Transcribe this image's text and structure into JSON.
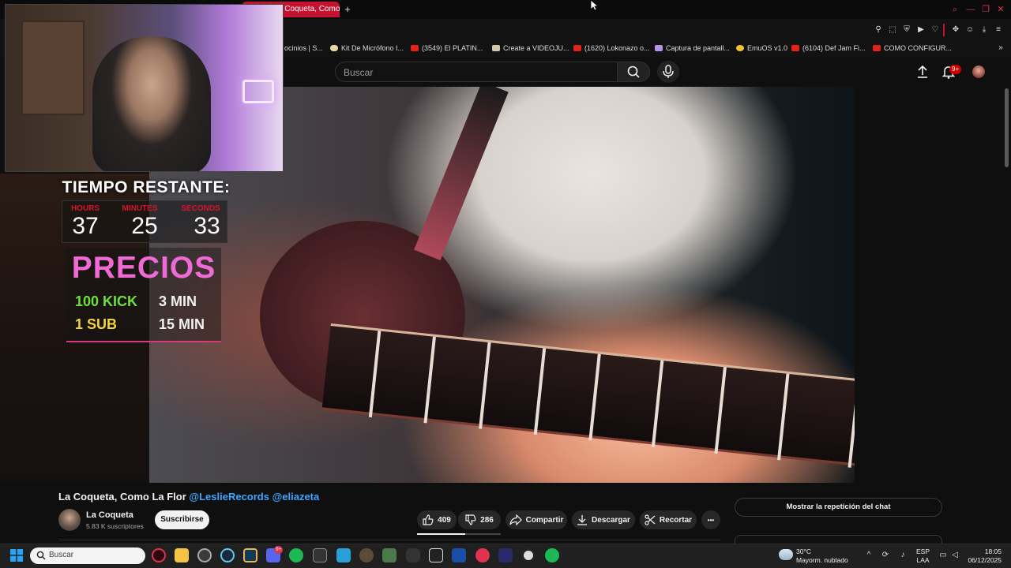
{
  "browser": {
    "active_tab_title": "a Coqueta, Como",
    "bookmarks": [
      {
        "label": "ocinios | S...",
        "icon": "page-icon"
      },
      {
        "label": "Kit De Micrófono I...",
        "icon": "pill-icon"
      },
      {
        "label": "(3549) El PLATIN...",
        "icon": "youtube-icon"
      },
      {
        "label": "Create a VIDEOJU...",
        "icon": "page-icon"
      },
      {
        "label": "(1620) Lokonazo o...",
        "icon": "youtube-icon"
      },
      {
        "label": "Captura de pantall...",
        "icon": "feather-icon"
      },
      {
        "label": "EmuOS v1.0",
        "icon": "sun-icon"
      },
      {
        "label": "(6104) Def Jam Fi...",
        "icon": "youtube-icon"
      },
      {
        "label": "COMO CONFIGUR...",
        "icon": "youtube-icon"
      }
    ],
    "accent_color": "#c41230"
  },
  "youtube": {
    "search_placeholder": "Buscar",
    "notifications_badge": "9+",
    "video_title_main": "La Coqueta, Como La Flor",
    "video_title_mentions": "@LeslieRecords @eliazeta",
    "channel_name": "La Coqueta",
    "subscribers": "5.83 K suscriptores",
    "subscribe_label": "Suscribirse",
    "likes": "409",
    "dislikes": "286",
    "share_label": "Compartir",
    "download_label": "Descargar",
    "clip_label": "Recortar",
    "more_label": "•••",
    "chat_replay_label": "Mostrar la repetición del chat"
  },
  "stream_overlay": {
    "timer_title": "TIEMPO RESTANTE:",
    "timer_labels": [
      "HOURS",
      "MINUTES",
      "SECONDS"
    ],
    "timer_values": [
      "37",
      "25",
      "33"
    ],
    "prices_title": "PRECIOS",
    "prices": [
      {
        "item": "100 KICK",
        "time": "3 MIN",
        "color": "#6ee03a"
      },
      {
        "item": "1 SUB",
        "time": "15 MIN",
        "color": "#f5d33a"
      }
    ]
  },
  "taskbar": {
    "search_placeholder": "Buscar",
    "weather_temp": "30°C",
    "weather_desc": "Mayorm. nublado",
    "lang_line1": "ESP",
    "lang_line2": "LAA",
    "time": "18:05",
    "date": "06/12/2025",
    "discord_badge": "9+"
  }
}
